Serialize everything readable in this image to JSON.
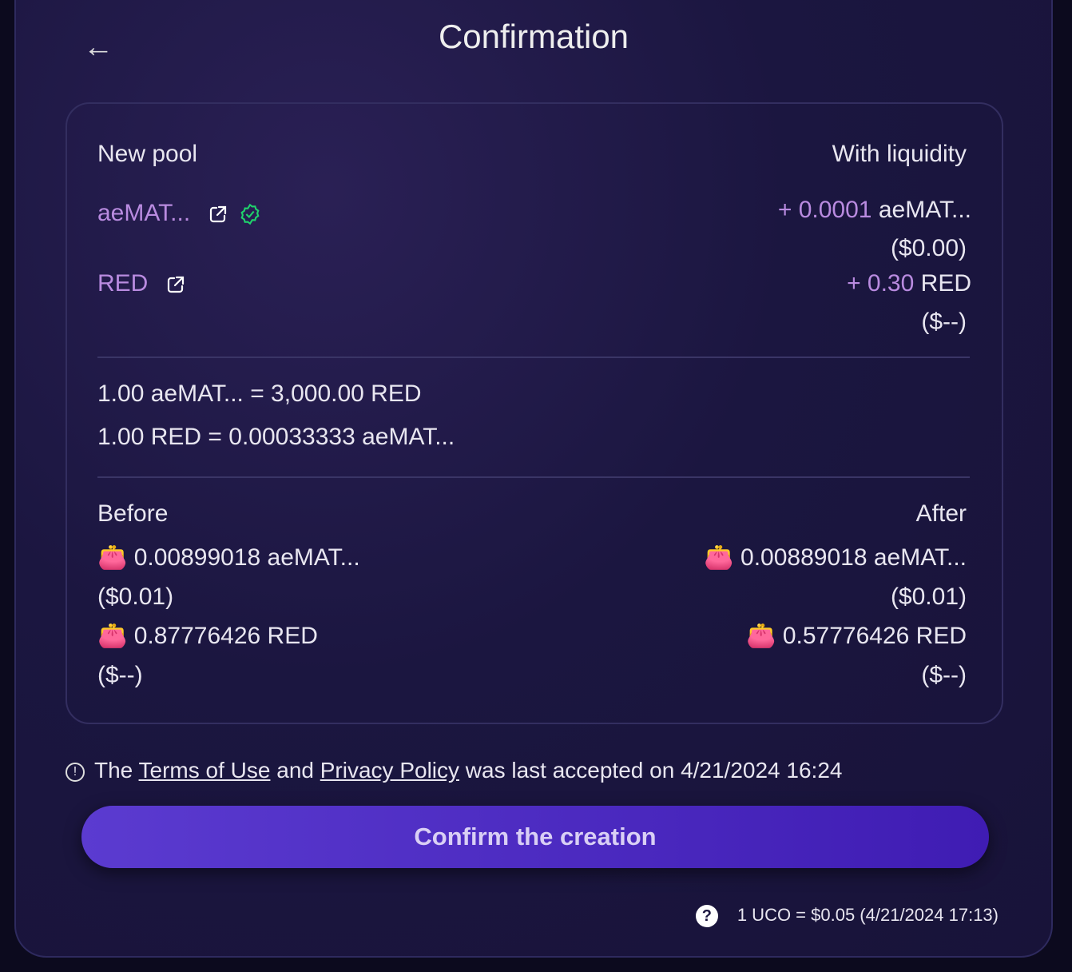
{
  "title": "Confirmation",
  "pool": {
    "heading_left": "New pool",
    "heading_right": "With liquidity",
    "token1": {
      "name": "aeMAT...",
      "amount_prefix": "+ 0.0001",
      "amount_suffix": "aeMAT...",
      "usd": "($0.00)"
    },
    "token2": {
      "name": "RED",
      "amount_prefix": "+ 0.30",
      "amount_suffix": "RED",
      "usd": "($--)"
    }
  },
  "rates": {
    "rate1": "1.00 aeMAT... = 3,000.00 RED",
    "rate2": "1.00 RED = 0.00033333 aeMAT..."
  },
  "balances": {
    "before_label": "Before",
    "after_label": "After",
    "before": [
      {
        "amount": "0.00899018 aeMAT...",
        "usd": "($0.01)"
      },
      {
        "amount": "0.87776426 RED",
        "usd": "($--)"
      }
    ],
    "after": [
      {
        "amount": "0.00889018 aeMAT...",
        "usd": "($0.01)"
      },
      {
        "amount": "0.57776426 RED",
        "usd": "($--)"
      }
    ]
  },
  "terms": {
    "p1": "The ",
    "terms_link": "Terms of Use",
    "p2": " and ",
    "privacy_link": "Privacy Policy",
    "p3": " was last accepted on 4/21/2024 16:24"
  },
  "confirm_label": "Confirm the creation",
  "footer": "1 UCO = $0.05 (4/21/2024 17:13)",
  "colors": {
    "accent": "#b98be0",
    "verified": "#1fd36b",
    "button": "#5b3bd0"
  }
}
